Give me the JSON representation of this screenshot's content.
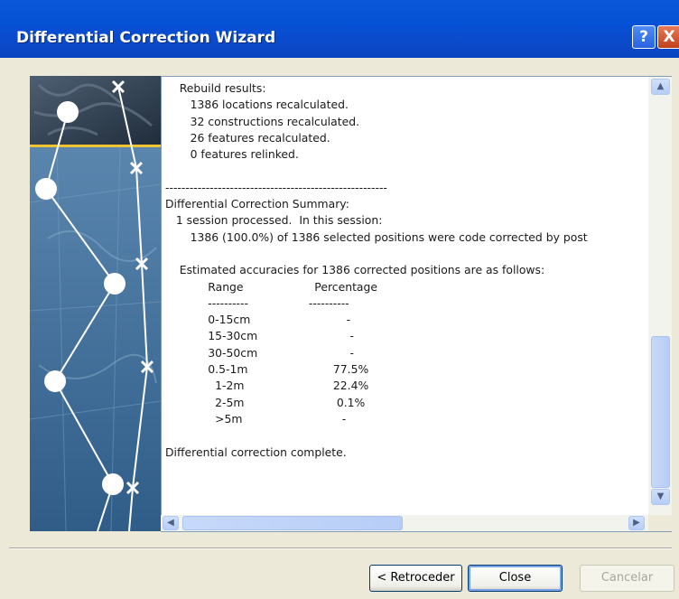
{
  "window": {
    "title": "Differential Correction Wizard"
  },
  "titlebar_buttons": {
    "help": "?",
    "close": "X"
  },
  "log": {
    "lines": [
      "    Rebuild results:",
      "       1386 locations recalculated.",
      "       32 constructions recalculated.",
      "       26 features recalculated.",
      "       0 features relinked.",
      "",
      "-------------------------------------------------------",
      "Differential Correction Summary:",
      "   1 session processed.  In this session:",
      "       1386 (100.0%) of 1386 selected positions were code corrected by post",
      "",
      "    Estimated accuracies for 1386 corrected positions are as follows:",
      "            Range                    Percentage",
      "            ----------                 ----------",
      "            0-15cm                           -",
      "            15-30cm                          -",
      "            30-50cm                          -",
      "            0.5-1m                        77.5%",
      "              1-2m                         22.4%",
      "              2-5m                          0.1%",
      "              >5m                            -",
      "",
      "Differential correction complete."
    ]
  },
  "buttons": {
    "back": "< Retroceder",
    "close": "Close",
    "cancel": "Cancelar"
  },
  "colors": {
    "titlebar": "#0a4ccf",
    "dialog_bg": "#ece9d8",
    "accent_line": "#f1c232"
  }
}
